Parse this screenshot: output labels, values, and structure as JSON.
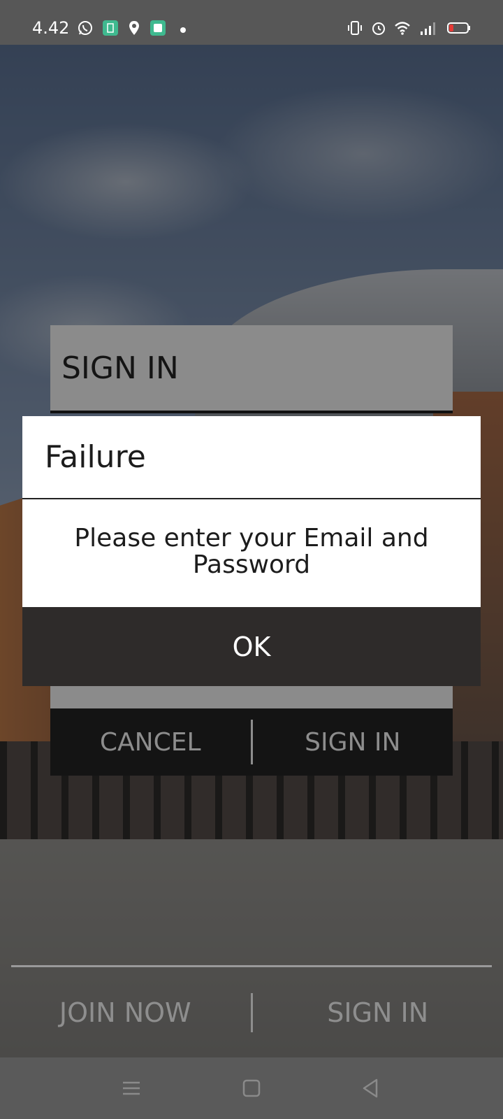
{
  "status_bar": {
    "time": "4.42",
    "left_icons": [
      "whatsapp-icon",
      "app-icon",
      "location-icon",
      "app-icon-2",
      "dot-icon"
    ],
    "right_icons": [
      "vibrate-icon",
      "alarm-icon",
      "wifi-icon",
      "signal-icon",
      "battery-icon"
    ]
  },
  "signin_panel": {
    "title": "SIGN IN",
    "cancel_label": "CANCEL",
    "signin_label": "SIGN IN"
  },
  "bottom_bar": {
    "join_label": "JOIN NOW",
    "signin_label": "SIGN IN"
  },
  "dialog": {
    "title": "Failure",
    "message": "Please enter your Email and Password",
    "ok_label": "OK"
  },
  "nav_bar": {
    "icons": [
      "menu-icon",
      "home-icon",
      "back-icon"
    ]
  },
  "colors": {
    "status_bar": "#575757",
    "dialog_button": "#2e2b2a",
    "signin_actions": "#141414",
    "battery_low": "#e53935"
  }
}
